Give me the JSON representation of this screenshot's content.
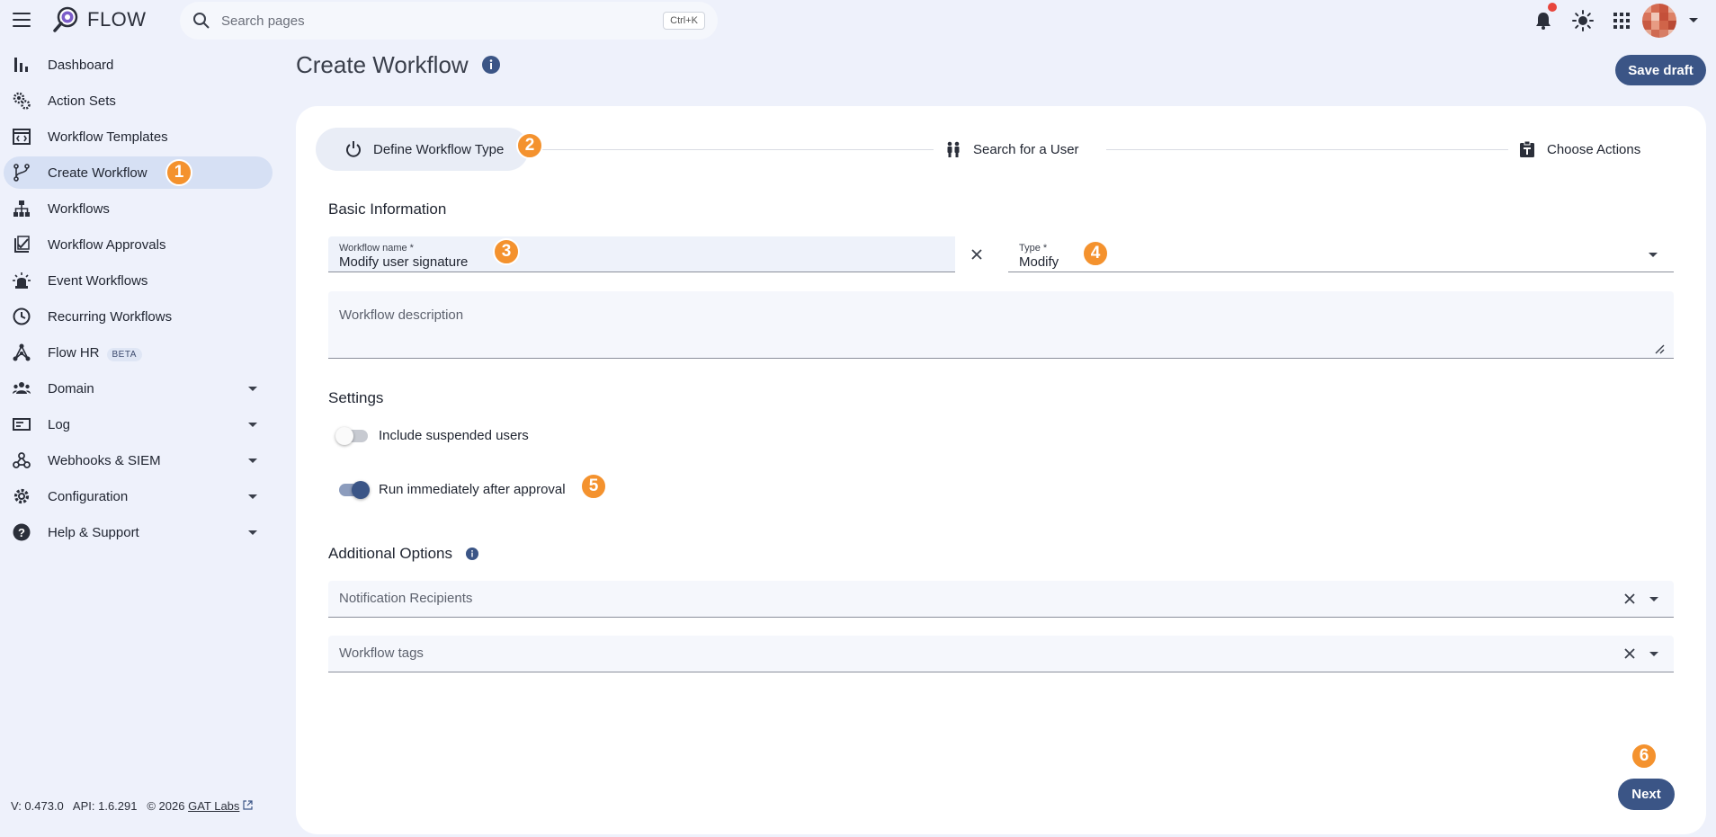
{
  "app": {
    "name": "FLOW"
  },
  "search": {
    "placeholder": "Search pages",
    "shortcut": "Ctrl+K"
  },
  "sidebar": {
    "items": [
      {
        "label": "Dashboard",
        "icon": "bar-chart-icon"
      },
      {
        "label": "Action Sets",
        "icon": "gears-icon"
      },
      {
        "label": "Workflow Templates",
        "icon": "template-icon"
      },
      {
        "label": "Create Workflow",
        "icon": "branch-icon",
        "active": true
      },
      {
        "label": "Workflows",
        "icon": "hierarchy-icon"
      },
      {
        "label": "Workflow Approvals",
        "icon": "checklist-icon"
      },
      {
        "label": "Event Workflows",
        "icon": "siren-icon"
      },
      {
        "label": "Recurring Workflows",
        "icon": "clock-icon"
      },
      {
        "label": "Flow HR",
        "icon": "network-icon",
        "badge": "BETA"
      },
      {
        "label": "Domain",
        "icon": "users-icon",
        "expandable": true
      },
      {
        "label": "Log",
        "icon": "log-icon",
        "expandable": true
      },
      {
        "label": "Webhooks & SIEM",
        "icon": "webhook-icon",
        "expandable": true
      },
      {
        "label": "Configuration",
        "icon": "gear-icon",
        "expandable": true
      },
      {
        "label": "Help & Support",
        "icon": "help-icon",
        "expandable": true
      }
    ]
  },
  "footer": {
    "version": "V: 0.473.0",
    "api": "API: 1.6.291",
    "copyright": "© 2026",
    "link": "GAT Labs"
  },
  "header": {
    "title": "Create Workflow",
    "save_label": "Save draft"
  },
  "stepper": {
    "steps": [
      {
        "label": "Define Workflow Type",
        "icon": "power-icon"
      },
      {
        "label": "Search for a User",
        "icon": "people-icon"
      },
      {
        "label": "Choose Actions",
        "icon": "clipboard-icon"
      }
    ]
  },
  "basic": {
    "title": "Basic Information",
    "name_label": "Workflow name *",
    "name_value": "Modify user signature",
    "type_label": "Type *",
    "type_value": "Modify",
    "description_placeholder": "Workflow description"
  },
  "settings": {
    "title": "Settings",
    "include_suspended": {
      "label": "Include suspended users",
      "on": false
    },
    "run_immediately": {
      "label": "Run immediately after approval",
      "on": true
    }
  },
  "additional": {
    "title": "Additional Options",
    "recipients_placeholder": "Notification Recipients",
    "tags_placeholder": "Workflow tags"
  },
  "next_label": "Next",
  "badges": [
    "1",
    "2",
    "3",
    "4",
    "5",
    "6"
  ],
  "colors": {
    "accent": "#3b5586",
    "badge": "#f4922e",
    "active_nav": "#d6e0f4",
    "alert": "#e8453c"
  }
}
